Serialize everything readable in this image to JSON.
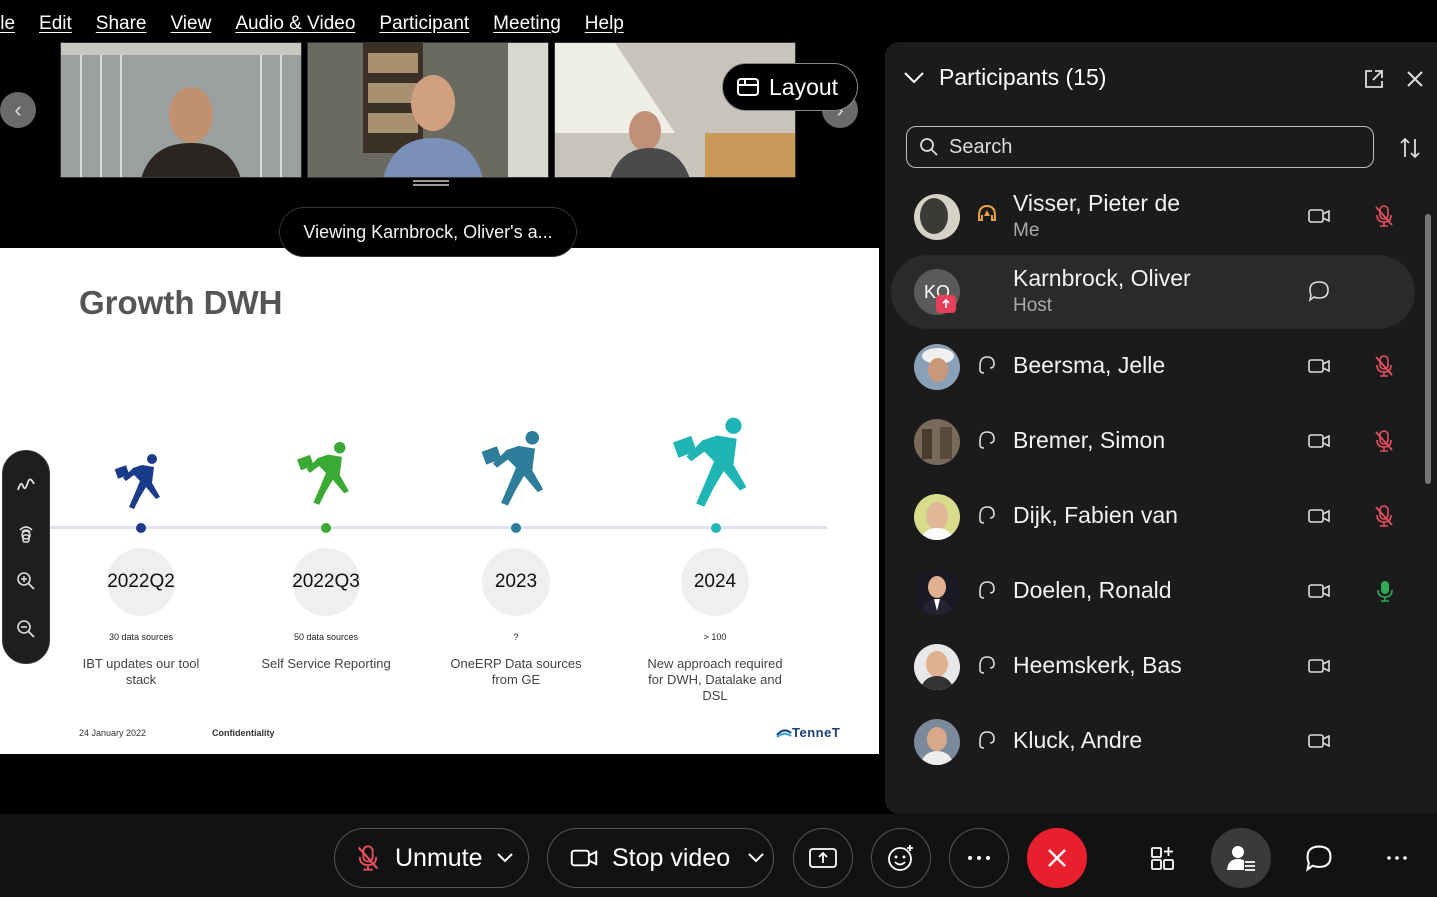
{
  "menu": [
    "ile",
    "Edit",
    "Share",
    "View",
    "Audio & Video",
    "Participant",
    "Meeting",
    "Help"
  ],
  "video_strip": {
    "layout_label": "Layout"
  },
  "viewing_banner": "Viewing Karnbrock, Oliver's a...",
  "slide": {
    "title": "Growth DWH",
    "milestones": [
      {
        "label": "2022Q2",
        "count": "30 data sources",
        "desc": "IBT updates our tool stack",
        "color": "#1a3a8a"
      },
      {
        "label": "2022Q3",
        "count": "50 data sources",
        "desc": "Self Service Reporting",
        "color": "#3aaa35"
      },
      {
        "label": "2023",
        "count": "?",
        "desc": "OneERP Data sources from GE",
        "color": "#2e7d9a"
      },
      {
        "label": "2024",
        "count": "> 100",
        "desc": "New approach required for DWH, Datalake and DSL",
        "color": "#20b5b5"
      }
    ],
    "footer_date": "24 January 2022",
    "footer_confidentiality": "Confidentiality",
    "brand": "TenneT"
  },
  "participants": {
    "title": "Participants (15)",
    "search_placeholder": "Search",
    "list": [
      {
        "name": "Visser, Pieter de",
        "role": "Me",
        "video": true,
        "mic": "muted"
      },
      {
        "name": "Karnbrock, Oliver",
        "role": "Host",
        "initials": "KO",
        "video": false,
        "mic": "none",
        "chat": true
      },
      {
        "name": "Beersma, Jelle",
        "role": "",
        "video": true,
        "mic": "muted"
      },
      {
        "name": "Bremer, Simon",
        "role": "",
        "video": true,
        "mic": "muted"
      },
      {
        "name": "Dijk, Fabien van",
        "role": "",
        "video": true,
        "mic": "muted"
      },
      {
        "name": "Doelen, Ronald",
        "role": "",
        "video": true,
        "mic": "active"
      },
      {
        "name": "Heemskerk, Bas",
        "role": "",
        "video": true,
        "mic": "none"
      },
      {
        "name": "Kluck, Andre",
        "role": "",
        "video": true,
        "mic": "none"
      }
    ]
  },
  "controls": {
    "unmute_label": "Unmute",
    "video_label": "Stop video",
    "end_color": "#e8202e"
  }
}
